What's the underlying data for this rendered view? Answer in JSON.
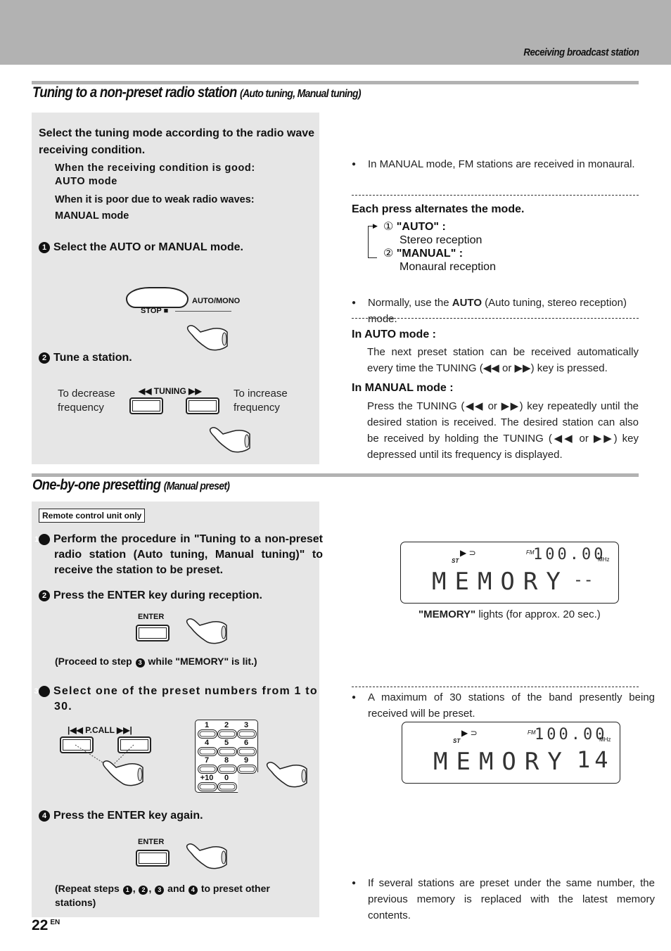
{
  "header": {
    "section_label": "Receiving broadcast station"
  },
  "section1": {
    "title": "Tuning to a non-preset radio station",
    "subtitle": "(Auto tuning, Manual tuning)",
    "intro": "Select the tuning mode according to the radio wave receiving condition.",
    "cond_good": "When the receiving condition is good:",
    "cond_good_mode": "AUTO mode",
    "cond_poor": "When it is poor due to weak radio waves:",
    "cond_poor_mode": "MANUAL mode",
    "step1": {
      "num": "1",
      "text": "Select the AUTO or MANUAL mode."
    },
    "step1_buttons": {
      "stop": "STOP ■",
      "auto_mono": "AUTO/MONO"
    },
    "step2": {
      "num": "2",
      "text": "Tune a station."
    },
    "step2_labels": {
      "decrease": "To decrease frequency",
      "tuning": "◀◀ TUNING ▶▶",
      "increase": "To increase frequency"
    },
    "note_manual": "In MANUAL mode, FM stations are received in monaural.",
    "alternates_title": "Each press alternates the mode.",
    "modes": [
      {
        "num": "①",
        "name": "\"AUTO\" :",
        "desc": "Stereo reception"
      },
      {
        "num": "②",
        "name": "\"MANUAL\" :",
        "desc": "Monaural reception"
      }
    ],
    "note_normally_pre": "Normally, use the ",
    "note_normally_bold": "AUTO",
    "note_normally_post": " (Auto tuning, stereo reception) mode.",
    "auto_mode_title": "In AUTO mode :",
    "auto_mode_text": "The next preset station can be received automatically every time the TUNING (◀◀ or ▶▶) key is pressed.",
    "manual_mode_title": "In MANUAL mode :",
    "manual_mode_text": "Press the TUNING (◀◀ or ▶▶) key repeatedly until the desired station is received. The desired station can also be received by holding the TUNING (◀◀ or ▶▶) key depressed until its frequency is displayed."
  },
  "section2": {
    "title": "One-by-one presetting",
    "subtitle": "(Manual preset)",
    "remote_only": "Remote control unit only",
    "step1": {
      "num": "1",
      "text": "Perform the procedure in \"Tuning to a non-preset radio station (Auto tuning, Manual tuning)\" to receive the station to be preset."
    },
    "step2": {
      "num": "2",
      "text": "Press the ENTER key during reception."
    },
    "enter_label": "ENTER",
    "proceed_pre": "(Proceed to step ",
    "proceed_num": "3",
    "proceed_post": " while \"MEMORY\" is lit.)",
    "step3": {
      "num": "3",
      "text": "Select one of the preset numbers from 1 to 30."
    },
    "pcall_label": "|◀◀ P.CALL ▶▶|",
    "keypad": [
      "1",
      "2",
      "3",
      "4",
      "5",
      "6",
      "7",
      "8",
      "9",
      "+10",
      "0"
    ],
    "step4": {
      "num": "4",
      "text": "Press the ENTER key again."
    },
    "repeat_pre": "(Repeat steps ",
    "repeat_nums": [
      "1",
      "2",
      "3",
      "4"
    ],
    "repeat_post": " to preset other stations)",
    "lcd1": {
      "band": "FM",
      "freq": "100.00",
      "unit": "MHz",
      "text": "MEMORY",
      "preset": "- -",
      "stereo": "ST"
    },
    "lcd1_caption_bold": "\"MEMORY\"",
    "lcd1_caption": " lights (for approx. 20 sec.)",
    "note_max": "A maximum of 30 stations of the band presently being received will be preset.",
    "lcd2": {
      "band": "FM",
      "freq": "100.00",
      "unit": "MHz",
      "text": "MEMORY",
      "preset": "14",
      "stereo": "ST"
    },
    "note_replace": "If several stations are preset under the same number, the previous memory is replaced with the latest memory contents."
  },
  "footer": {
    "page_num": "22",
    "lang": "EN"
  }
}
